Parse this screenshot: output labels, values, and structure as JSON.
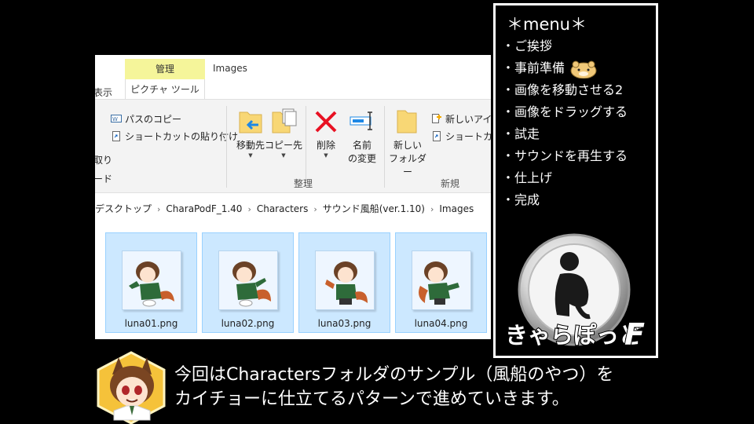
{
  "explorer": {
    "context_tab": "管理",
    "title": "Images",
    "tab_left": "表示",
    "tab_picture_tools": "ピクチャ ツール",
    "ribbon": {
      "copy_path": "パスのコピー",
      "paste_shortcut": "ショートカットの貼り付け",
      "partial_cut": "取り",
      "partial_mode": "ード",
      "move_to": "移動先",
      "copy_to": "コピー先",
      "delete": "削除",
      "rename_1": "名前",
      "rename_2": "の変更",
      "new_folder_1": "新しい",
      "new_folder_2": "フォルダー",
      "new_item": "新しいアイ",
      "shortcut": "ショートカッ",
      "group_organize": "整理",
      "group_new": "新規"
    },
    "breadcrumb": [
      "デスクトップ",
      "CharaPodF_1.40",
      "Characters",
      "サウンド風船(ver.1.10)",
      "Images"
    ],
    "files": [
      "luna01.png",
      "luna02.png",
      "luna03.png",
      "luna04.png"
    ]
  },
  "menu": {
    "title": "＊menu＊",
    "items": [
      "・ご挨拶",
      "・事前準備",
      "・画像を移動させる2",
      "・画像をドラッグする",
      "・試走",
      "・サウンドを再生する",
      "・仕上げ",
      "・完成"
    ],
    "logo_text": "きゃらぽっどF"
  },
  "subtitle": {
    "line1": "今回はCharactersフォルダのサンプル（風船のやつ）を",
    "line2": "カイチョーに仕立てるパターンで進めていきます。"
  },
  "colors": {
    "context_tab_bg": "#f5f59a",
    "selection_bg": "#cce8ff",
    "selection_border": "#99d1ff",
    "delete_red": "#e81123",
    "folder_yellow": "#f8d775"
  }
}
